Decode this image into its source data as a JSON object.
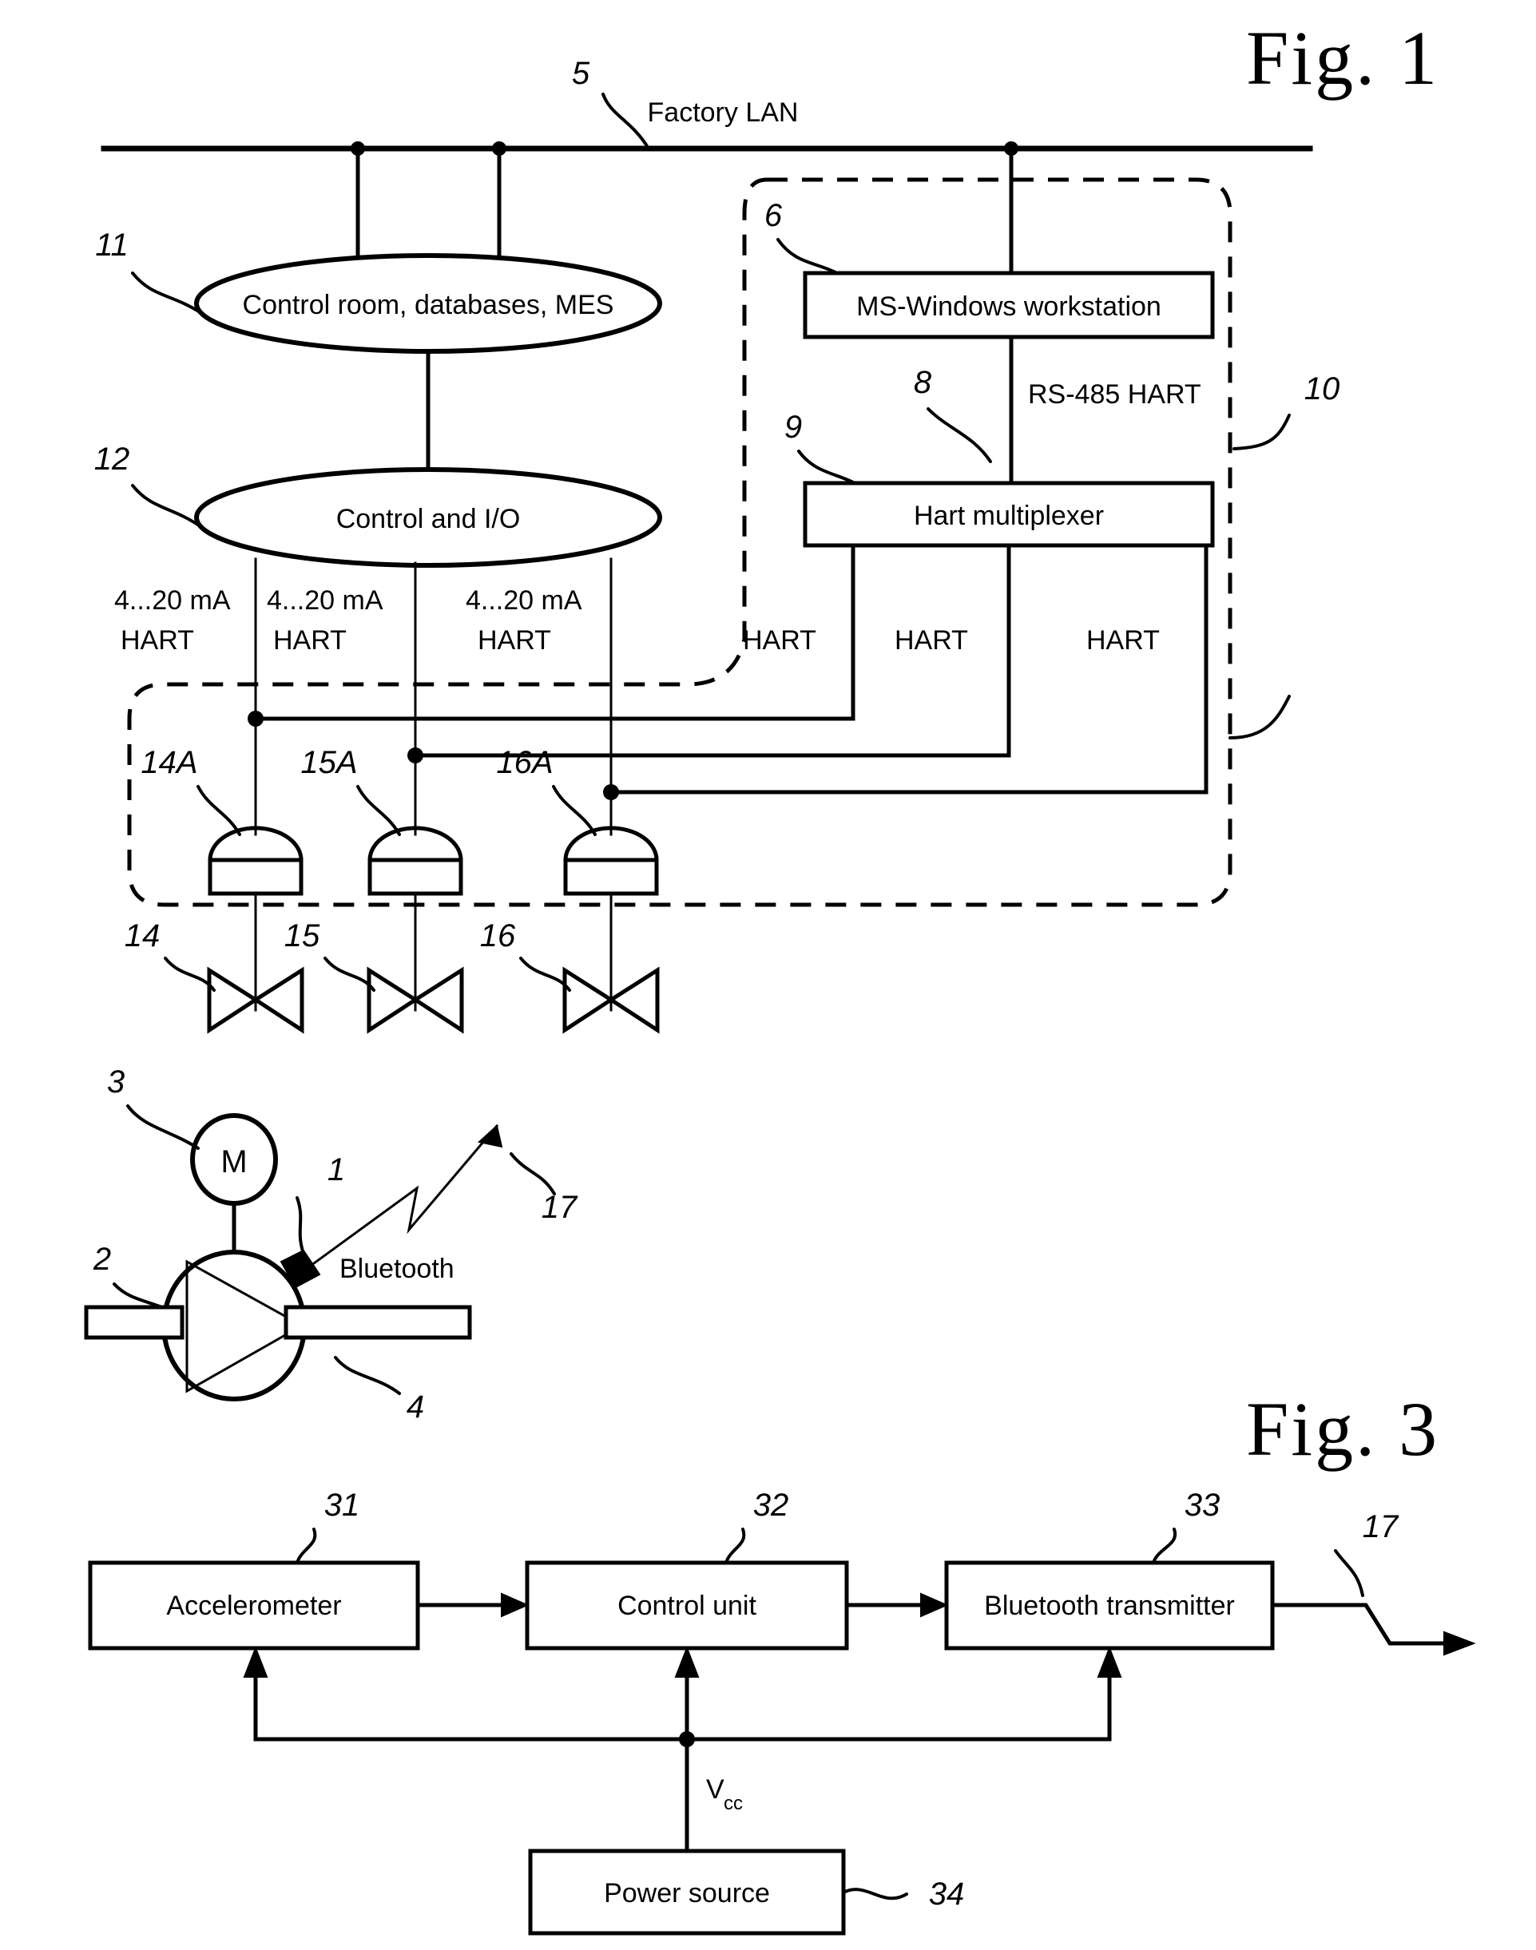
{
  "figures": [
    {
      "id": "fig1",
      "title": "Fig. 1",
      "bus_label": "Factory LAN",
      "nodes": {
        "control_room": "Control room, databases, MES",
        "control_io": "Control and  I/O",
        "workstation": "MS-Windows workstation",
        "multiplexer": "Hart multiplexer"
      },
      "wire_labels": {
        "rs485": "RS-485 HART",
        "analog_1": "4...20 mA",
        "analog_1b": "HART",
        "analog_2": "4...20 mA",
        "analog_2b": "HART",
        "analog_3": "4...20 mA",
        "analog_3b": "HART",
        "hart_1": "HART",
        "hart_2": "HART",
        "hart_3": "HART"
      },
      "reference_numerals": {
        "bus": "5",
        "control_room": "11",
        "control_io": "12",
        "workstation": "6",
        "rs485_link": "8",
        "multiplexer": "9",
        "boundary": "10",
        "positioner_1": "14A",
        "positioner_2": "15A",
        "positioner_3": "16A",
        "valve_1": "14",
        "valve_2": "15",
        "valve_3": "16"
      }
    },
    {
      "id": "fig2",
      "title": "",
      "labels": {
        "motor_glyph": "M",
        "bluetooth": "Bluetooth"
      },
      "reference_numerals": {
        "sensor": "1",
        "pump": "2",
        "motor": "3",
        "pipe": "4",
        "radio_link": "17"
      }
    },
    {
      "id": "fig3",
      "title": "Fig. 3",
      "blocks": {
        "accelerometer": "Accelerometer",
        "control_unit": "Control unit",
        "bluetooth_transmitter": "Bluetooth transmitter",
        "power_source": "Power source"
      },
      "labels": {
        "vcc": "V",
        "vcc_sub": "cc"
      },
      "reference_numerals": {
        "accelerometer": "31",
        "control_unit": "32",
        "bluetooth_transmitter": "33",
        "power_source": "34",
        "radio_link": "17"
      }
    }
  ]
}
